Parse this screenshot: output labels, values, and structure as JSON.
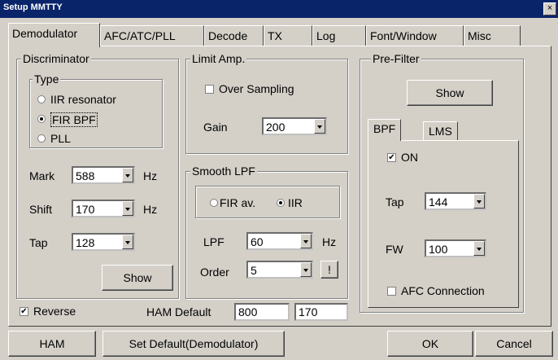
{
  "window": {
    "title": "Setup MMTTY",
    "close_glyph": "×"
  },
  "tabs": [
    "Demodulator",
    "AFC/ATC/PLL",
    "Decode",
    "TX",
    "Log",
    "Font/Window",
    "Misc"
  ],
  "discriminator": {
    "title": "Discriminator",
    "type_title": "Type",
    "types": [
      {
        "label": "IIR resonator",
        "selected": false
      },
      {
        "label": "FIR BPF",
        "selected": true
      },
      {
        "label": "PLL",
        "selected": false
      }
    ],
    "mark": {
      "label": "Mark",
      "value": "588",
      "unit": "Hz"
    },
    "shift": {
      "label": "Shift",
      "value": "170",
      "unit": "Hz"
    },
    "tap": {
      "label": "Tap",
      "value": "128"
    },
    "show_button": "Show"
  },
  "limit_amp": {
    "title": "Limit Amp.",
    "over_sampling_label": "Over Sampling",
    "over_sampling_checked": false,
    "gain": {
      "label": "Gain",
      "value": "200"
    }
  },
  "smooth_lpf": {
    "title": "Smooth LPF",
    "fir_av_label": "FIR av.",
    "fir_av_selected": false,
    "iir_label": "IIR",
    "iir_selected": true,
    "lpf": {
      "label": "LPF",
      "value": "60",
      "unit": "Hz"
    },
    "order": {
      "label": "Order",
      "value": "5"
    },
    "help_button": "!"
  },
  "pre_filter": {
    "title": "Pre-Filter",
    "show_button": "Show",
    "subtabs": [
      "BPF",
      "LMS"
    ],
    "on_label": "ON",
    "on_checked": true,
    "tap": {
      "label": "Tap",
      "value": "144"
    },
    "fw": {
      "label": "FW",
      "value": "100"
    },
    "afc_connection_label": "AFC Connection",
    "afc_connection_checked": false
  },
  "reverse": {
    "label": "Reverse",
    "checked": true
  },
  "ham_default": {
    "label": "HAM Default",
    "mark": "800",
    "shift": "170"
  },
  "buttons": {
    "ham": "HAM",
    "set_default": "Set Default(Demodulator)",
    "ok": "OK",
    "cancel": "Cancel"
  },
  "check_glyph": "✔"
}
